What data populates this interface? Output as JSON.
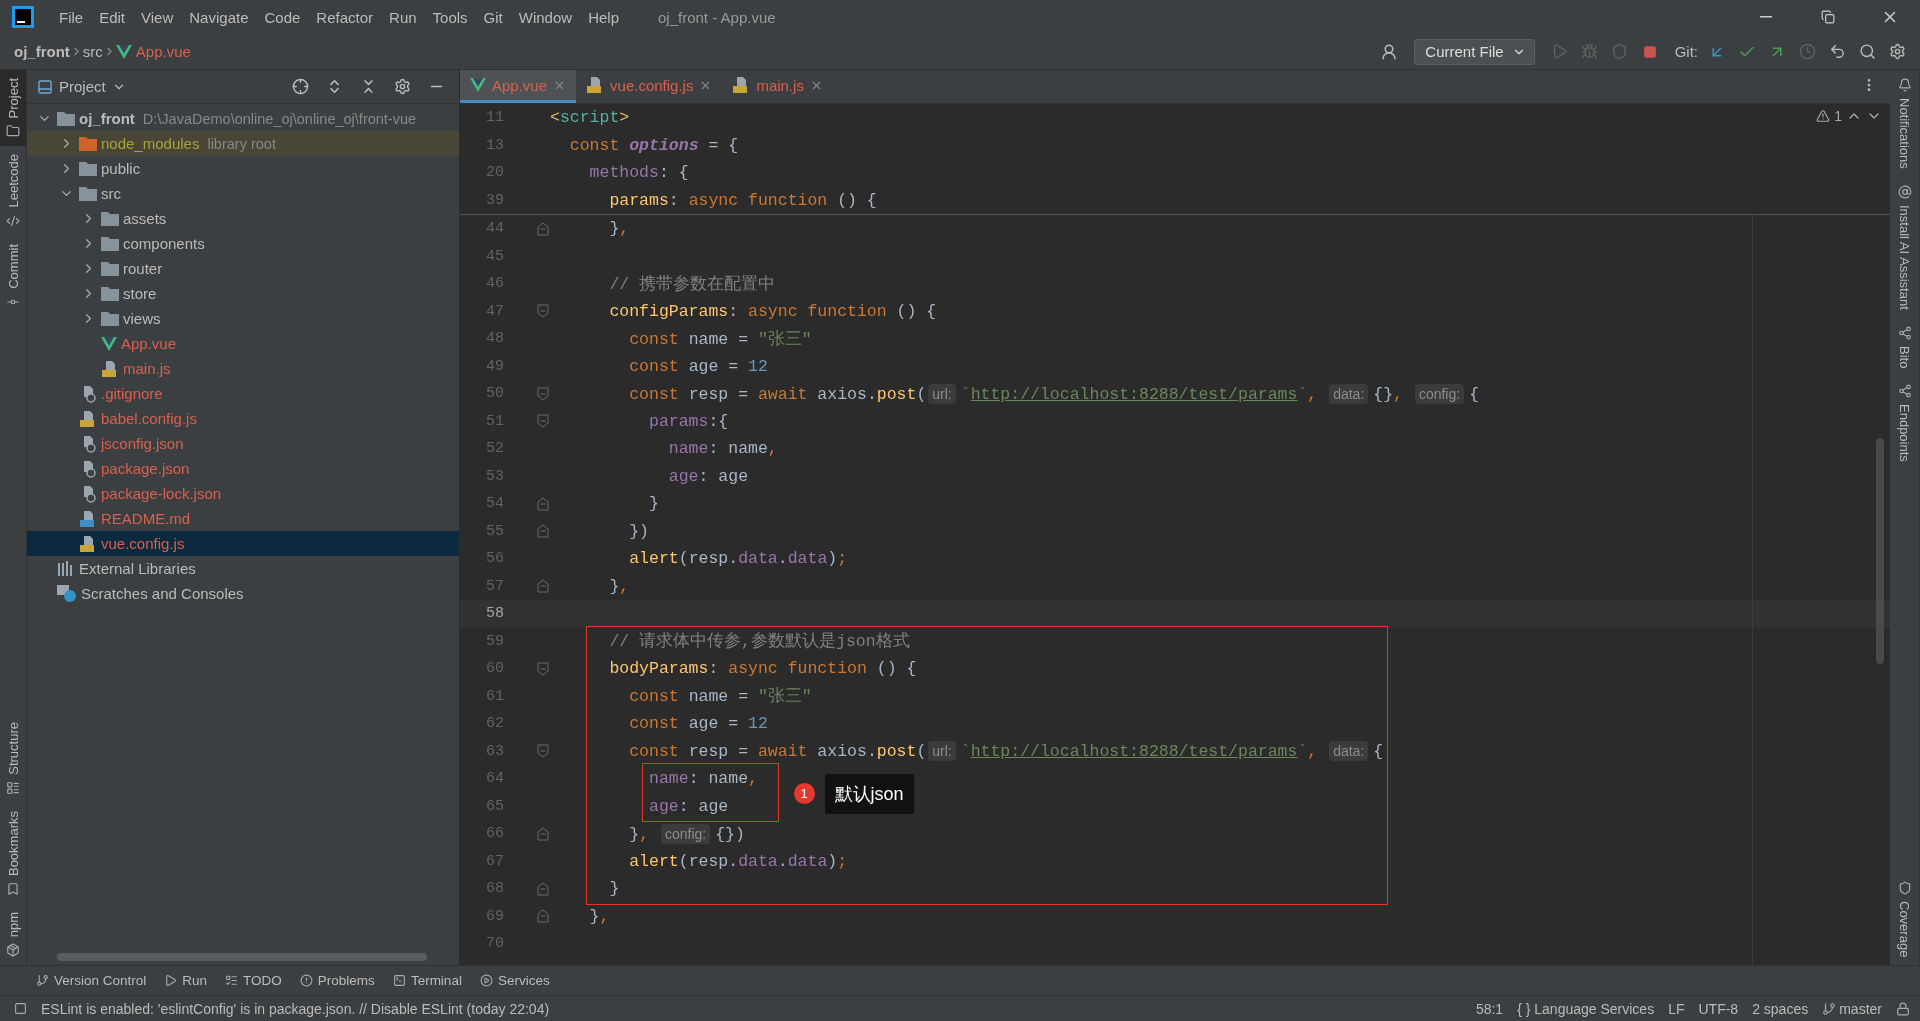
{
  "window": {
    "title": "oj_front - App.vue"
  },
  "menu": [
    "File",
    "Edit",
    "View",
    "Navigate",
    "Code",
    "Refactor",
    "Run",
    "Tools",
    "Git",
    "Window",
    "Help"
  ],
  "breadcrumb": [
    {
      "label": "oj_front",
      "kind": "project"
    },
    {
      "label": "src",
      "kind": "folder"
    },
    {
      "label": "App.vue",
      "kind": "vue"
    }
  ],
  "toolbar": {
    "run_config": "Current File",
    "vcs_label": "Git:"
  },
  "left_toolbar": {
    "top": [
      {
        "label": "Project",
        "selected": true
      },
      {
        "label": "Leetcode",
        "selected": false
      },
      {
        "label": "Commit",
        "selected": false
      }
    ],
    "bottom": [
      {
        "label": "Structure",
        "selected": false
      },
      {
        "label": "Bookmarks",
        "selected": false
      },
      {
        "label": "npm",
        "selected": false
      }
    ]
  },
  "right_toolbar": {
    "top": [
      "Notifications",
      "Install AI Assistant",
      "Bito",
      "Endpoints"
    ],
    "bottom": [
      "Coverage"
    ]
  },
  "project_panel": {
    "title": "Project",
    "tree": [
      {
        "name": "oj_front",
        "hint": "D:\\JavaDemo\\online_oj\\online_oj\\front-vue",
        "kind": "module",
        "untracked": false,
        "ignored": false,
        "expanded": true,
        "selected": false,
        "children": [
          {
            "name": "node_modules",
            "hint": "library root",
            "kind": "library",
            "untracked": false,
            "ignored": true,
            "expanded": false,
            "selected": false
          },
          {
            "name": "public",
            "kind": "folder",
            "untracked": false,
            "ignored": false,
            "expanded": false,
            "selected": false
          },
          {
            "name": "src",
            "kind": "folder",
            "untracked": false,
            "ignored": false,
            "expanded": true,
            "selected": false,
            "children": [
              {
                "name": "assets",
                "kind": "folder",
                "untracked": false,
                "ignored": false,
                "expanded": false,
                "selected": false
              },
              {
                "name": "components",
                "kind": "folder",
                "untracked": false,
                "ignored": false,
                "expanded": false,
                "selected": false
              },
              {
                "name": "router",
                "kind": "folder",
                "untracked": false,
                "ignored": false,
                "expanded": false,
                "selected": false
              },
              {
                "name": "store",
                "kind": "folder",
                "untracked": false,
                "ignored": false,
                "expanded": false,
                "selected": false
              },
              {
                "name": "views",
                "kind": "folder",
                "untracked": false,
                "ignored": false,
                "expanded": false,
                "selected": false
              },
              {
                "name": "App.vue",
                "kind": "vue",
                "untracked": true,
                "ignored": false,
                "selected": false
              },
              {
                "name": "main.js",
                "kind": "js",
                "untracked": true,
                "ignored": false,
                "selected": false
              }
            ]
          },
          {
            "name": ".gitignore",
            "kind": "ignore",
            "untracked": true,
            "ignored": false,
            "selected": false
          },
          {
            "name": "babel.config.js",
            "kind": "js",
            "untracked": true,
            "ignored": false,
            "selected": false
          },
          {
            "name": "jsconfig.json",
            "kind": "json",
            "untracked": true,
            "ignored": false,
            "selected": false
          },
          {
            "name": "package.json",
            "kind": "json",
            "untracked": true,
            "ignored": false,
            "selected": false
          },
          {
            "name": "package-lock.json",
            "kind": "json",
            "untracked": true,
            "ignored": false,
            "selected": false
          },
          {
            "name": "README.md",
            "kind": "md",
            "untracked": true,
            "ignored": false,
            "selected": false
          },
          {
            "name": "vue.config.js",
            "kind": "js",
            "untracked": true,
            "ignored": false,
            "selected": true
          }
        ]
      },
      {
        "name": "External Libraries",
        "kind": "libraries",
        "untracked": false,
        "ignored": false,
        "selected": false
      },
      {
        "name": "Scratches and Consoles",
        "kind": "scratches",
        "untracked": false,
        "ignored": false,
        "selected": false
      }
    ]
  },
  "tabs": [
    {
      "label": "App.vue",
      "kind": "vue",
      "selected": true
    },
    {
      "label": "vue.config.js",
      "kind": "js",
      "selected": false
    },
    {
      "label": "main.js",
      "kind": "js",
      "selected": false
    }
  ],
  "editor": {
    "warnings": "1",
    "sticky_lines": [
      {
        "number": "11",
        "tokens": [
          {
            "kind": "tag_bracket",
            "text": "<"
          },
          {
            "kind": "tag_name",
            "text": "script"
          },
          {
            "kind": "tag_bracket",
            "text": ">"
          }
        ]
      },
      {
        "number": "13",
        "tokens": [
          {
            "kind": "keyword",
            "text": "  const "
          },
          {
            "kind": "constant",
            "text": "options"
          },
          {
            "kind": "plain",
            "text": " = {"
          }
        ]
      },
      {
        "number": "20",
        "tokens": [
          {
            "kind": "property",
            "text": "    methods"
          },
          {
            "kind": "plain",
            "text": ": {"
          }
        ]
      },
      {
        "number": "39",
        "tokens": [
          {
            "kind": "function",
            "text": "      params"
          },
          {
            "kind": "plain",
            "text": ": "
          },
          {
            "kind": "keyword",
            "text": "async function"
          },
          {
            "kind": "plain",
            "text": " () {"
          }
        ]
      }
    ],
    "lines": [
      {
        "number": "44",
        "fold_end": true,
        "tokens": [
          {
            "kind": "plain",
            "text": "      }"
          },
          {
            "kind": "keyword",
            "text": ","
          }
        ]
      },
      {
        "number": "45"
      },
      {
        "number": "46",
        "tokens": [
          {
            "kind": "comment",
            "text": "      // 携带参数在配置中"
          }
        ]
      },
      {
        "number": "47",
        "fold_start": true,
        "tokens": [
          {
            "kind": "function",
            "text": "      configParams"
          },
          {
            "kind": "plain",
            "text": ": "
          },
          {
            "kind": "keyword",
            "text": "async function"
          },
          {
            "kind": "plain",
            "text": " () {"
          }
        ]
      },
      {
        "number": "48",
        "tokens": [
          {
            "kind": "keyword",
            "text": "        const"
          },
          {
            "kind": "plain",
            "text": " name = "
          },
          {
            "kind": "string",
            "text": "\"张三\""
          }
        ]
      },
      {
        "number": "49",
        "tokens": [
          {
            "kind": "keyword",
            "text": "        const"
          },
          {
            "kind": "plain",
            "text": " age = "
          },
          {
            "kind": "number",
            "text": "12"
          }
        ]
      },
      {
        "number": "50",
        "fold_start": true,
        "tokens": [
          {
            "kind": "keyword",
            "text": "        const"
          },
          {
            "kind": "plain",
            "text": " resp = "
          },
          {
            "kind": "keyword",
            "text": "await"
          },
          {
            "kind": "plain",
            "text": " axios."
          },
          {
            "kind": "function",
            "text": "post"
          },
          {
            "kind": "plain",
            "text": "("
          },
          {
            "kind": "hint",
            "text": "url:"
          },
          {
            "kind": "string",
            "text": "`"
          },
          {
            "kind": "link",
            "text": "http://localhost:8288/test/params"
          },
          {
            "kind": "string",
            "text": "`"
          },
          {
            "kind": "keyword",
            "text": ", "
          },
          {
            "kind": "hint",
            "text": "data:"
          },
          {
            "kind": "plain",
            "text": "{}"
          },
          {
            "kind": "keyword",
            "text": ", "
          },
          {
            "kind": "hint",
            "text": "config:"
          },
          {
            "kind": "plain",
            "text": "{"
          }
        ]
      },
      {
        "number": "51",
        "fold_start": true,
        "tokens": [
          {
            "kind": "property",
            "text": "          params"
          },
          {
            "kind": "plain",
            "text": ":{"
          }
        ]
      },
      {
        "number": "52",
        "tokens": [
          {
            "kind": "property",
            "text": "            name"
          },
          {
            "kind": "plain",
            "text": ": name"
          },
          {
            "kind": "keyword",
            "text": ","
          }
        ]
      },
      {
        "number": "53",
        "tokens": [
          {
            "kind": "property",
            "text": "            age"
          },
          {
            "kind": "plain",
            "text": ": age"
          }
        ]
      },
      {
        "number": "54",
        "fold_end": true,
        "tokens": [
          {
            "kind": "plain",
            "text": "          }"
          }
        ]
      },
      {
        "number": "55",
        "fold_end": true,
        "tokens": [
          {
            "kind": "plain",
            "text": "        })"
          }
        ]
      },
      {
        "number": "56",
        "tokens": [
          {
            "kind": "function",
            "text": "        alert"
          },
          {
            "kind": "plain",
            "text": "(resp."
          },
          {
            "kind": "property",
            "text": "data"
          },
          {
            "kind": "plain",
            "text": "."
          },
          {
            "kind": "property",
            "text": "data"
          },
          {
            "kind": "plain",
            "text": ")"
          },
          {
            "kind": "keyword",
            "text": ";"
          }
        ]
      },
      {
        "number": "57",
        "fold_end": true,
        "tokens": [
          {
            "kind": "plain",
            "text": "      }"
          },
          {
            "kind": "keyword",
            "text": ","
          }
        ]
      },
      {
        "number": "58",
        "current": true
      },
      {
        "number": "59",
        "framed": true,
        "tokens": [
          {
            "kind": "comment",
            "text": "      // 请求体中传参,参数默认是json格式"
          }
        ]
      },
      {
        "number": "60",
        "framed": true,
        "fold_start": true,
        "tokens": [
          {
            "kind": "function",
            "text": "      bodyParams"
          },
          {
            "kind": "plain",
            "text": ": "
          },
          {
            "kind": "keyword",
            "text": "async function"
          },
          {
            "kind": "plain",
            "text": " () {"
          }
        ]
      },
      {
        "number": "61",
        "framed": true,
        "tokens": [
          {
            "kind": "keyword",
            "text": "        const"
          },
          {
            "kind": "plain",
            "text": " name = "
          },
          {
            "kind": "string",
            "text": "\"张三\""
          }
        ]
      },
      {
        "number": "62",
        "framed": true,
        "tokens": [
          {
            "kind": "keyword",
            "text": "        const"
          },
          {
            "kind": "plain",
            "text": " age = "
          },
          {
            "kind": "number",
            "text": "12"
          }
        ]
      },
      {
        "number": "63",
        "framed": true,
        "fold_start": true,
        "tokens": [
          {
            "kind": "keyword",
            "text": "        const"
          },
          {
            "kind": "plain",
            "text": " resp = "
          },
          {
            "kind": "keyword",
            "text": "await"
          },
          {
            "kind": "plain",
            "text": " axios."
          },
          {
            "kind": "function",
            "text": "post"
          },
          {
            "kind": "plain",
            "text": "("
          },
          {
            "kind": "hint",
            "text": "url:"
          },
          {
            "kind": "string",
            "text": "`"
          },
          {
            "kind": "link",
            "text": "http://localhost:8288/test/params"
          },
          {
            "kind": "string",
            "text": "`"
          },
          {
            "kind": "keyword",
            "text": ", "
          },
          {
            "kind": "hint",
            "text": "data:"
          },
          {
            "kind": "plain",
            "text": "{"
          }
        ]
      },
      {
        "number": "64",
        "framed": true,
        "marked": true,
        "tokens": [
          {
            "kind": "property",
            "text": "          name"
          },
          {
            "kind": "plain",
            "text": ": name"
          },
          {
            "kind": "keyword",
            "text": ","
          }
        ]
      },
      {
        "number": "65",
        "framed": true,
        "marked": true,
        "tokens": [
          {
            "kind": "property",
            "text": "          age"
          },
          {
            "kind": "plain",
            "text": ": age"
          }
        ]
      },
      {
        "number": "66",
        "framed": true,
        "fold_end": true,
        "tokens": [
          {
            "kind": "plain",
            "text": "        }"
          },
          {
            "kind": "keyword",
            "text": ", "
          },
          {
            "kind": "hint",
            "text": "config:"
          },
          {
            "kind": "plain",
            "text": "{})"
          }
        ]
      },
      {
        "number": "67",
        "framed": true,
        "tokens": [
          {
            "kind": "function",
            "text": "        alert"
          },
          {
            "kind": "plain",
            "text": "(resp."
          },
          {
            "kind": "property",
            "text": "data"
          },
          {
            "kind": "plain",
            "text": "."
          },
          {
            "kind": "property",
            "text": "data"
          },
          {
            "kind": "plain",
            "text": ")"
          },
          {
            "kind": "keyword",
            "text": ";"
          }
        ]
      },
      {
        "number": "68",
        "framed": true,
        "fold_end": true,
        "tokens": [
          {
            "kind": "plain",
            "text": "      }"
          }
        ]
      },
      {
        "number": "69",
        "fold_end": true,
        "tokens": [
          {
            "kind": "plain",
            "text": "    }"
          },
          {
            "kind": "keyword",
            "text": ","
          }
        ]
      },
      {
        "number": "70"
      }
    ],
    "callout": {
      "badge": "1",
      "text": "默认json"
    }
  },
  "tool_tabs": [
    "Version Control",
    "Run",
    "TODO",
    "Problems",
    "Terminal",
    "Services"
  ],
  "status_bar": {
    "message": "ESLint is enabled: 'eslintConfig' is in package.json. // Disable ESLint (today 22:04)",
    "items": [
      "58:1",
      "{ } Language Services",
      "LF",
      "UTF-8",
      "2 spaces",
      "master"
    ]
  }
}
